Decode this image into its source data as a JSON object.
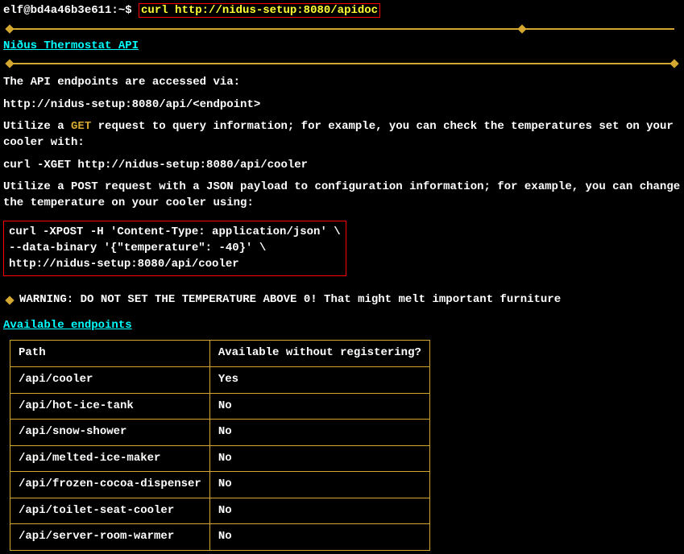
{
  "prompt": "elf@bd4a46b3e611:~$ ",
  "command": "curl http://nidus-setup:8080/apidoc",
  "heading1": "Niðus Thermostat API",
  "intro1": "The API endpoints are accessed via:",
  "intro2": "http://nidus-setup:8080/api/<endpoint>",
  "intro3a": "Utilize a ",
  "getkw": "GET",
  "intro3b": " request to query information; for example, you can check the temperatures set on your cooler with:",
  "intro4": "curl -XGET http://nidus-setup:8080/api/cooler",
  "intro5": "Utilize a POST request with a JSON payload to configuration information; for example, you can change the temperature on your cooler using:",
  "codeblock": {
    "l1": "curl -XPOST -H 'Content-Type: application/json' \\",
    "l2": "  --data-binary '{\"temperature\": -40}' \\",
    "l3": "  http://nidus-setup:8080/api/cooler"
  },
  "warning": "WARNING: DO NOT SET THE TEMPERATURE ABOVE 0! That might melt important furniture",
  "heading2": "Available endpoints",
  "table": {
    "headers": [
      "Path",
      "Available without registering?"
    ],
    "rows": [
      [
        "/api/cooler",
        "Yes"
      ],
      [
        "/api/hot-ice-tank",
        "No"
      ],
      [
        "/api/snow-shower",
        "No"
      ],
      [
        "/api/melted-ice-maker",
        "No"
      ],
      [
        "/api/frozen-cocoa-dispenser",
        "No"
      ],
      [
        "/api/toilet-seat-cooler",
        "No"
      ],
      [
        "/api/server-room-warmer",
        "No"
      ]
    ]
  }
}
